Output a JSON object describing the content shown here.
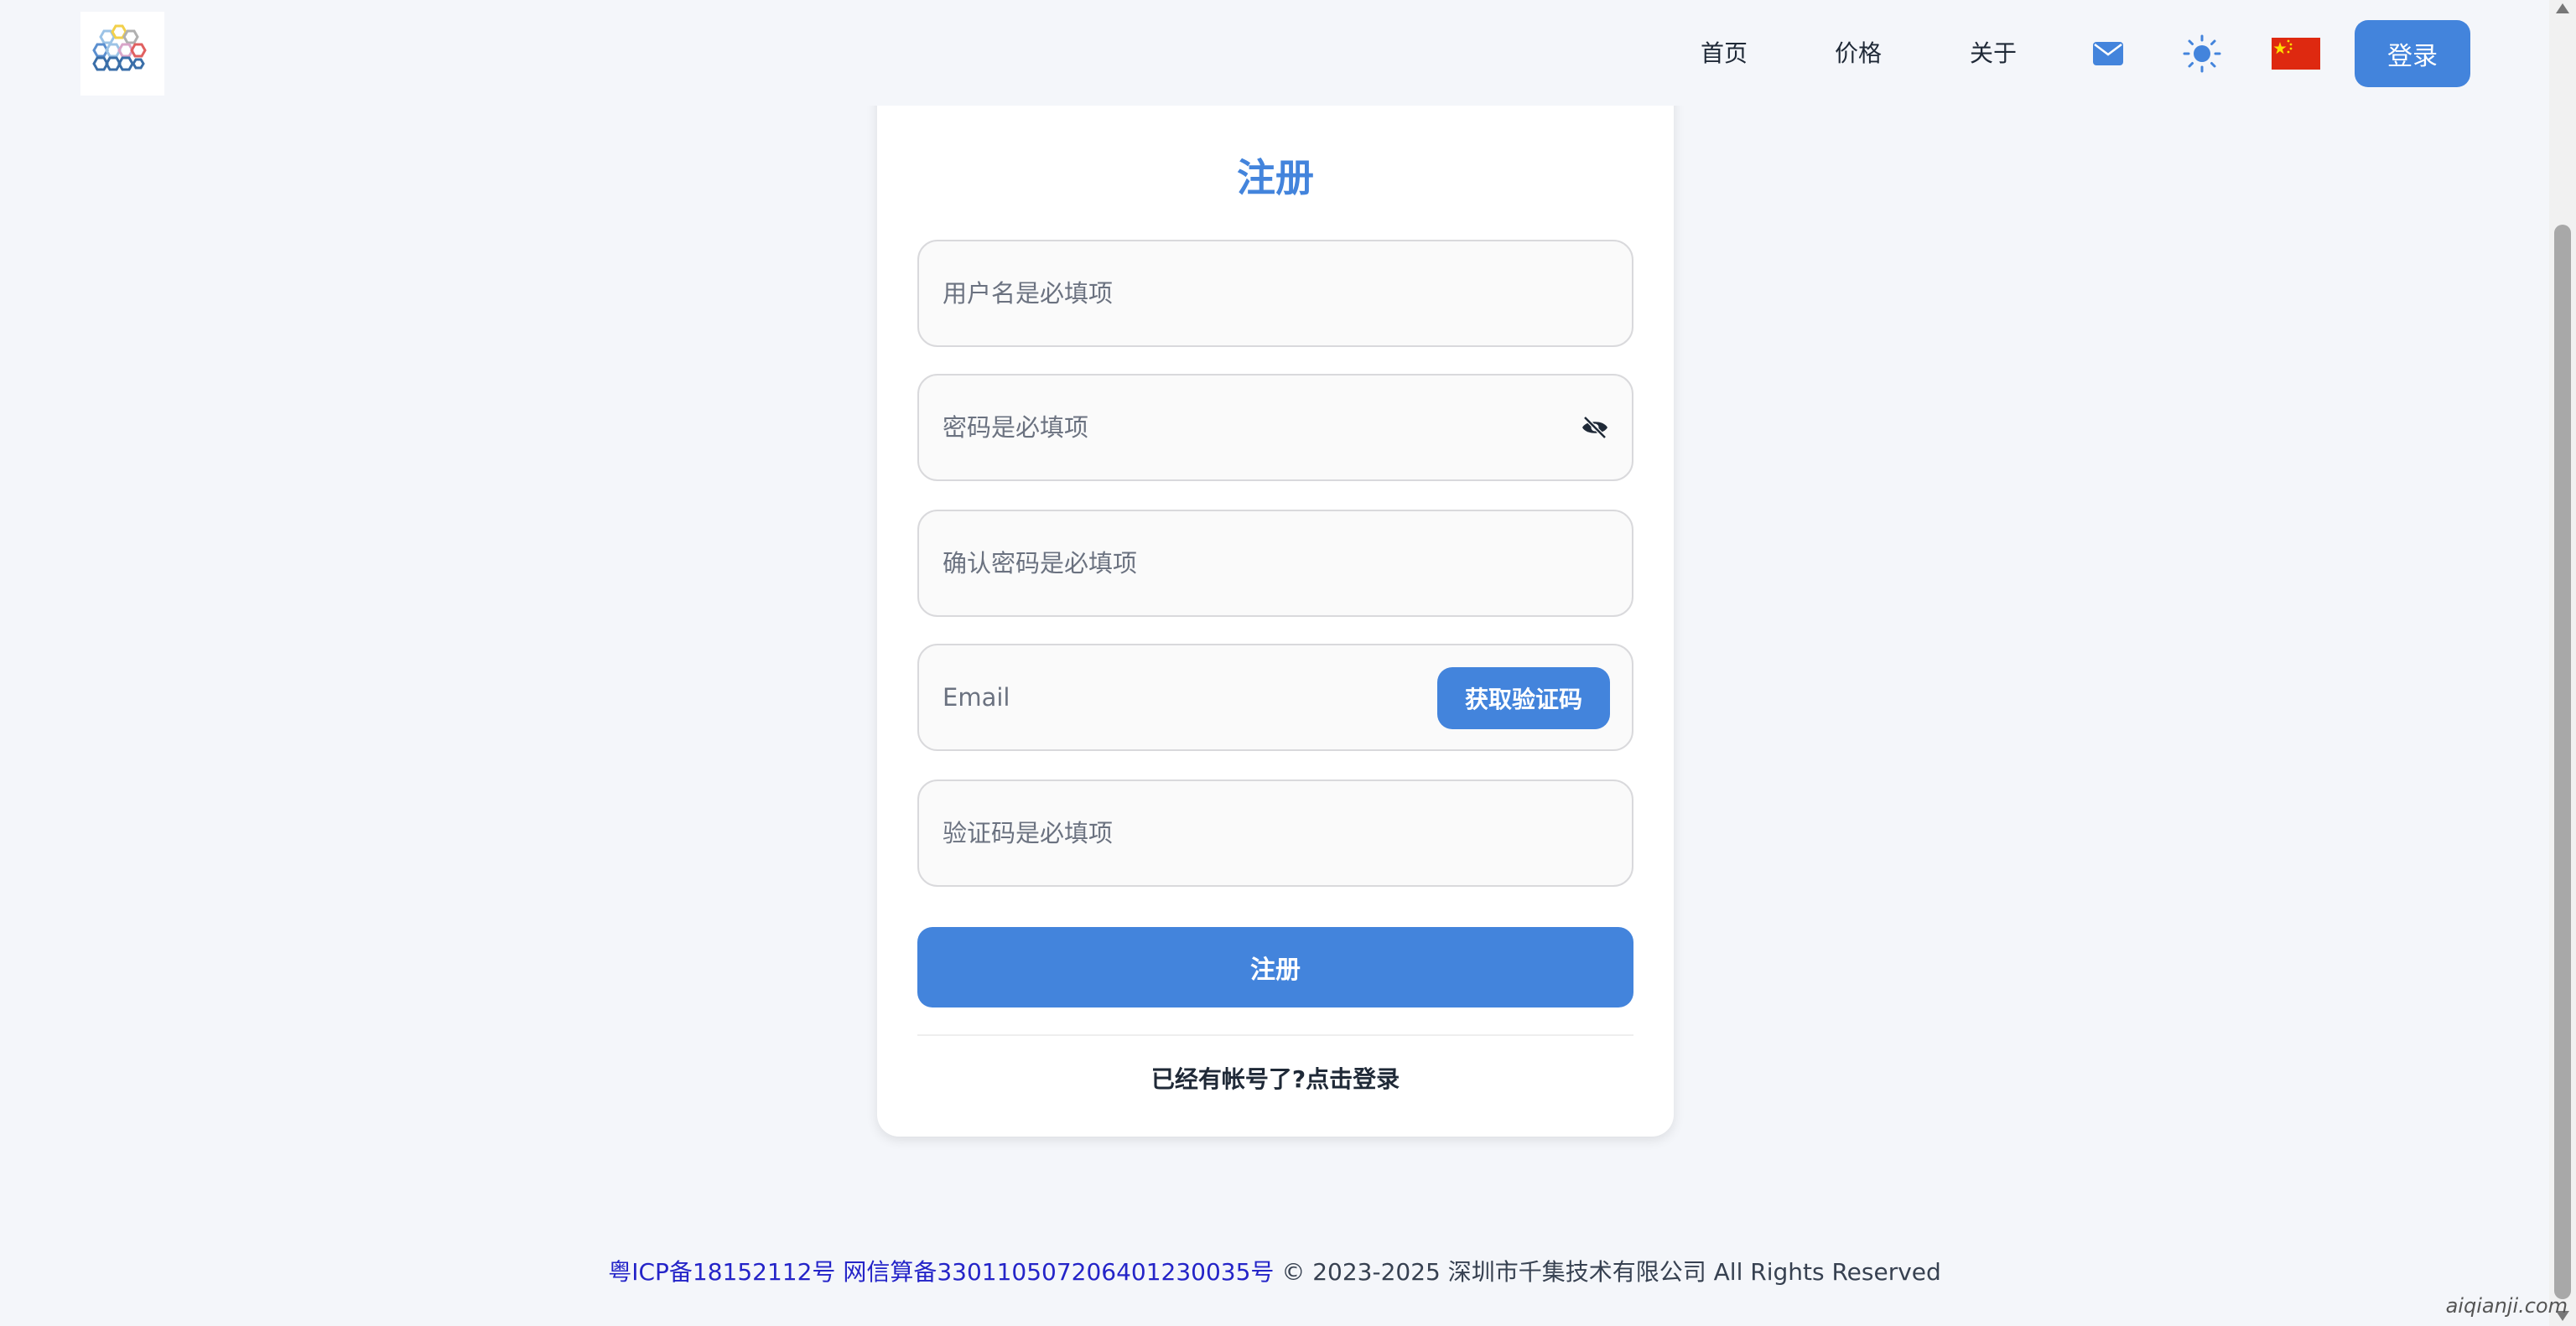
{
  "header": {
    "logo_icon": "hexagon-cluster-logo",
    "nav": {
      "home": "首页",
      "price": "价格",
      "about": "关于"
    },
    "mail_icon": "mail-icon",
    "theme_icon": "sun-icon",
    "flag_icon": "china-flag-icon",
    "login_label": "登录"
  },
  "form": {
    "title": "注册",
    "username_placeholder": "用户名是必填项",
    "password_placeholder": "密码是必填项",
    "confirm_placeholder": "确认密码是必填项",
    "email_placeholder": "Email",
    "get_code_label": "获取验证码",
    "code_placeholder": "验证码是必填项",
    "submit_label": "注册",
    "login_prompt": "已经有帐号了?点击登录",
    "eye_icon": "eye-off-icon"
  },
  "footer": {
    "icp": "粤ICP备18152112号",
    "algo": "网信算备330110507206401230035号",
    "copyright": "© 2023-2025 深圳市千集技术有限公司 All Rights Reserved"
  },
  "watermark": "aiqianji.com",
  "colors": {
    "accent": "#4384dc",
    "background": "#f4f6fa",
    "footer_link": "#2424c8"
  }
}
